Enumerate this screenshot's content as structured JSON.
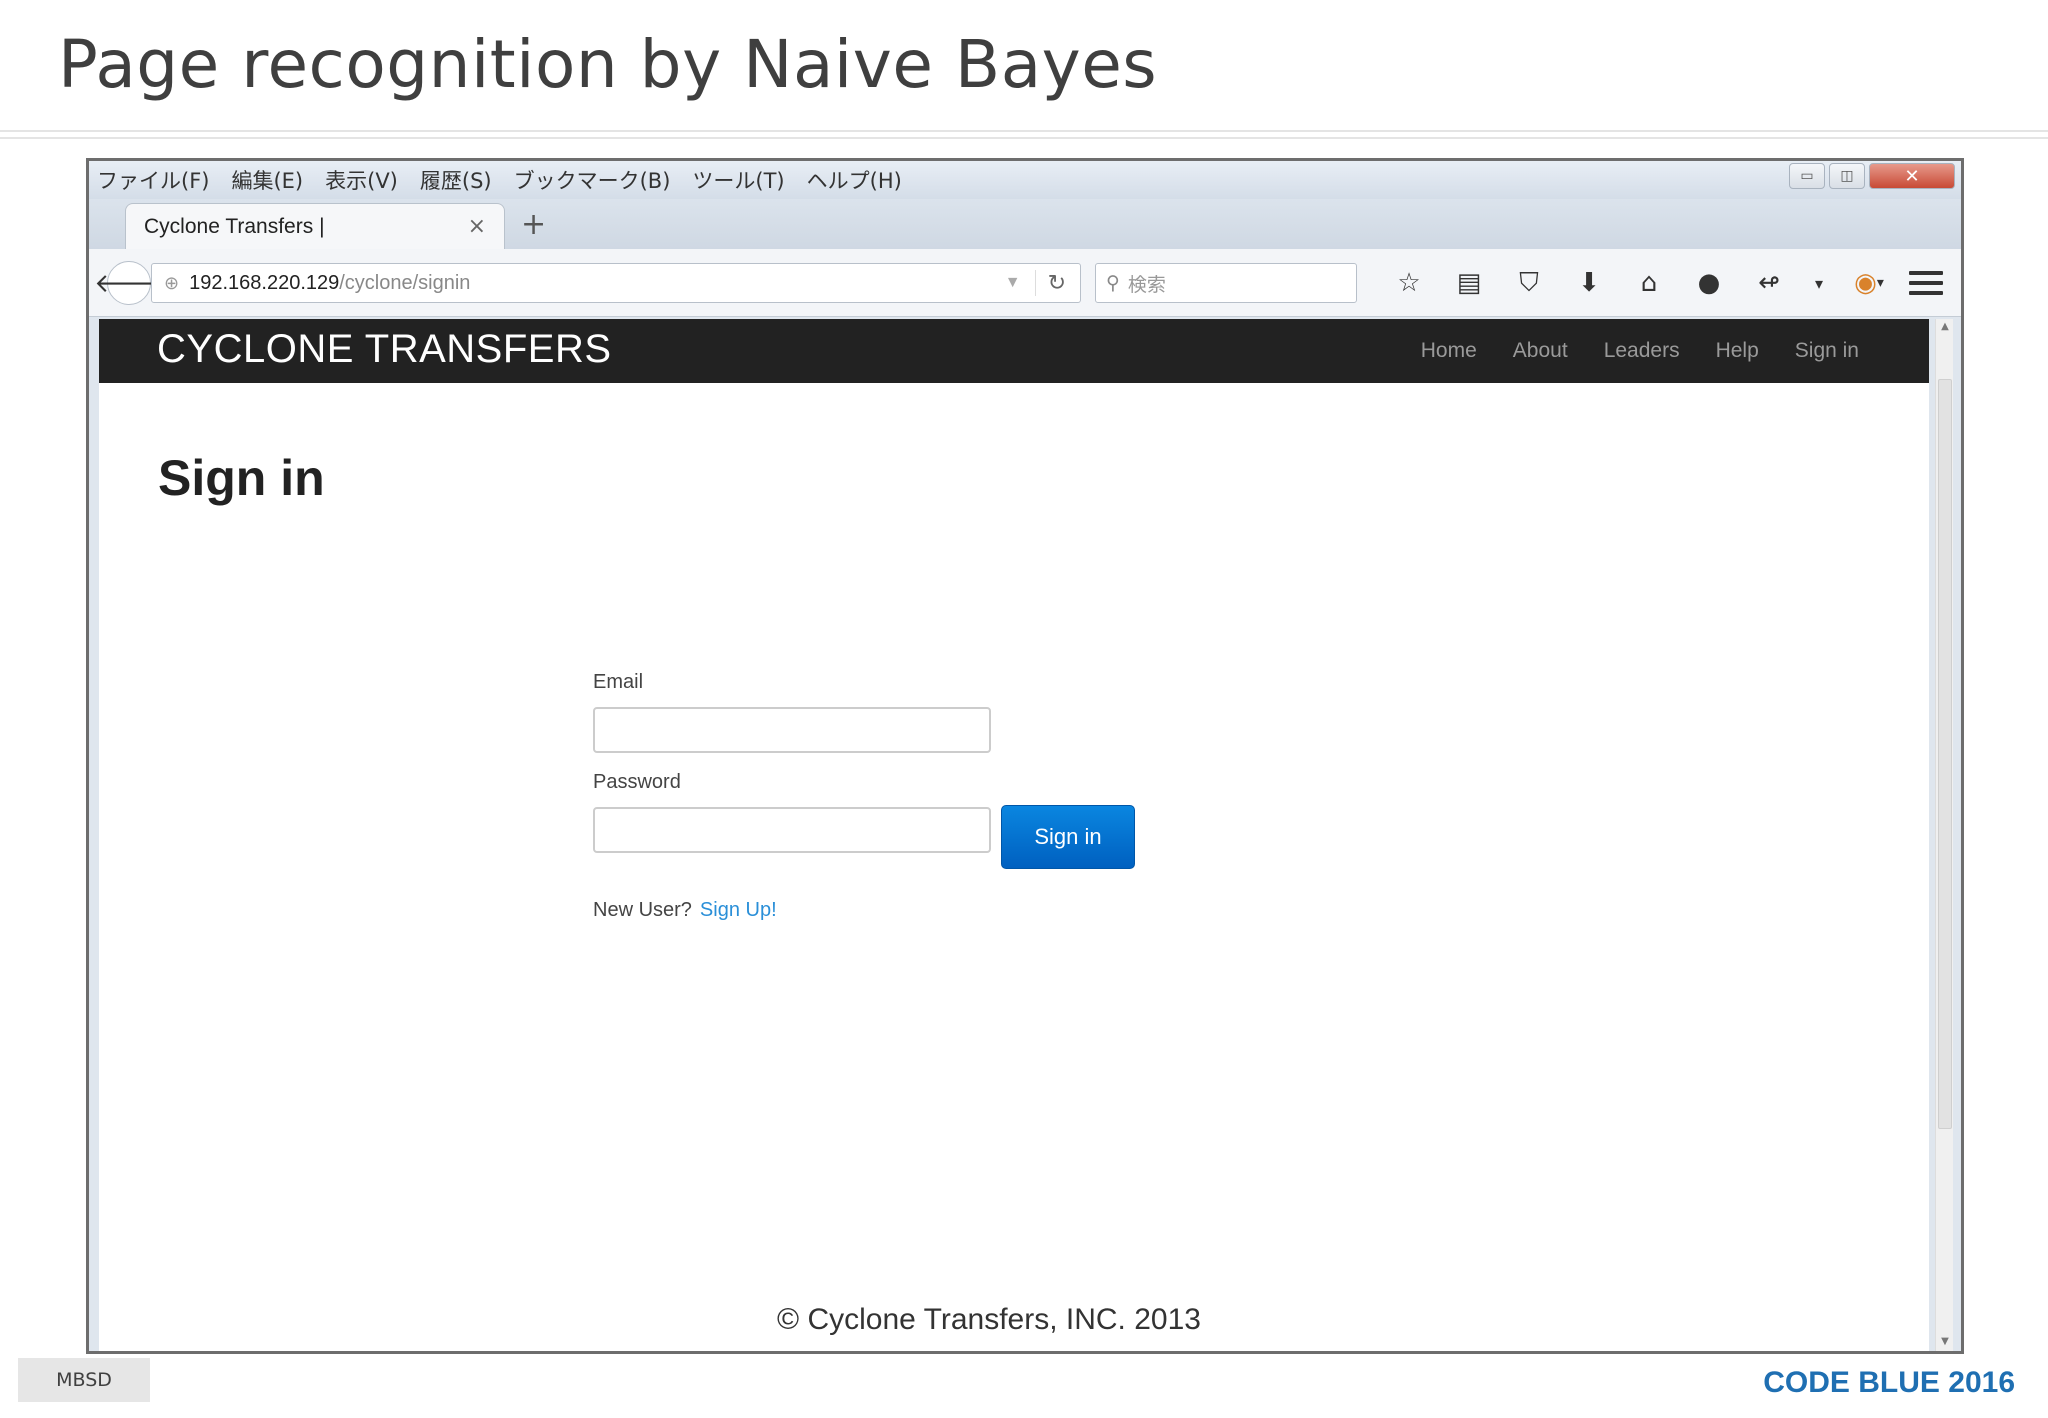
{
  "slide": {
    "title": "Page recognition by Naive Bayes",
    "footer_badge": "MBSD",
    "footer_brand": "CODE BLUE 2016"
  },
  "browser": {
    "menu": [
      "ファイル(F)",
      "編集(E)",
      "表示(V)",
      "履歴(S)",
      "ブックマーク(B)",
      "ツール(T)",
      "ヘルプ(H)"
    ],
    "tab_title": "Cyclone Transfers |",
    "url_host": "192.168.220.129",
    "url_path": "/cyclone/signin",
    "search_placeholder": "検索",
    "toolbar_icons": [
      "star-icon",
      "clipboard-icon",
      "pocket-icon",
      "download-icon",
      "home-icon",
      "chat-icon",
      "share-icon",
      "dropdown-icon",
      "avatar-icon"
    ]
  },
  "site": {
    "brand": "CYCLONE TRANSFERS",
    "nav": [
      "Home",
      "About",
      "Leaders",
      "Help",
      "Sign in"
    ],
    "heading": "Sign in",
    "email_label": "Email",
    "email_value": "",
    "password_label": "Password",
    "password_value": "",
    "signin_button": "Sign in",
    "new_user_text": "New User?",
    "signup_link": "Sign Up!",
    "copyright": "© Cyclone Transfers, INC. 2013"
  },
  "colors": {
    "site_header": "#222222",
    "signin_button": "#0a7bd6",
    "link": "#2a8fd8",
    "brand": "#1f6fb2"
  }
}
